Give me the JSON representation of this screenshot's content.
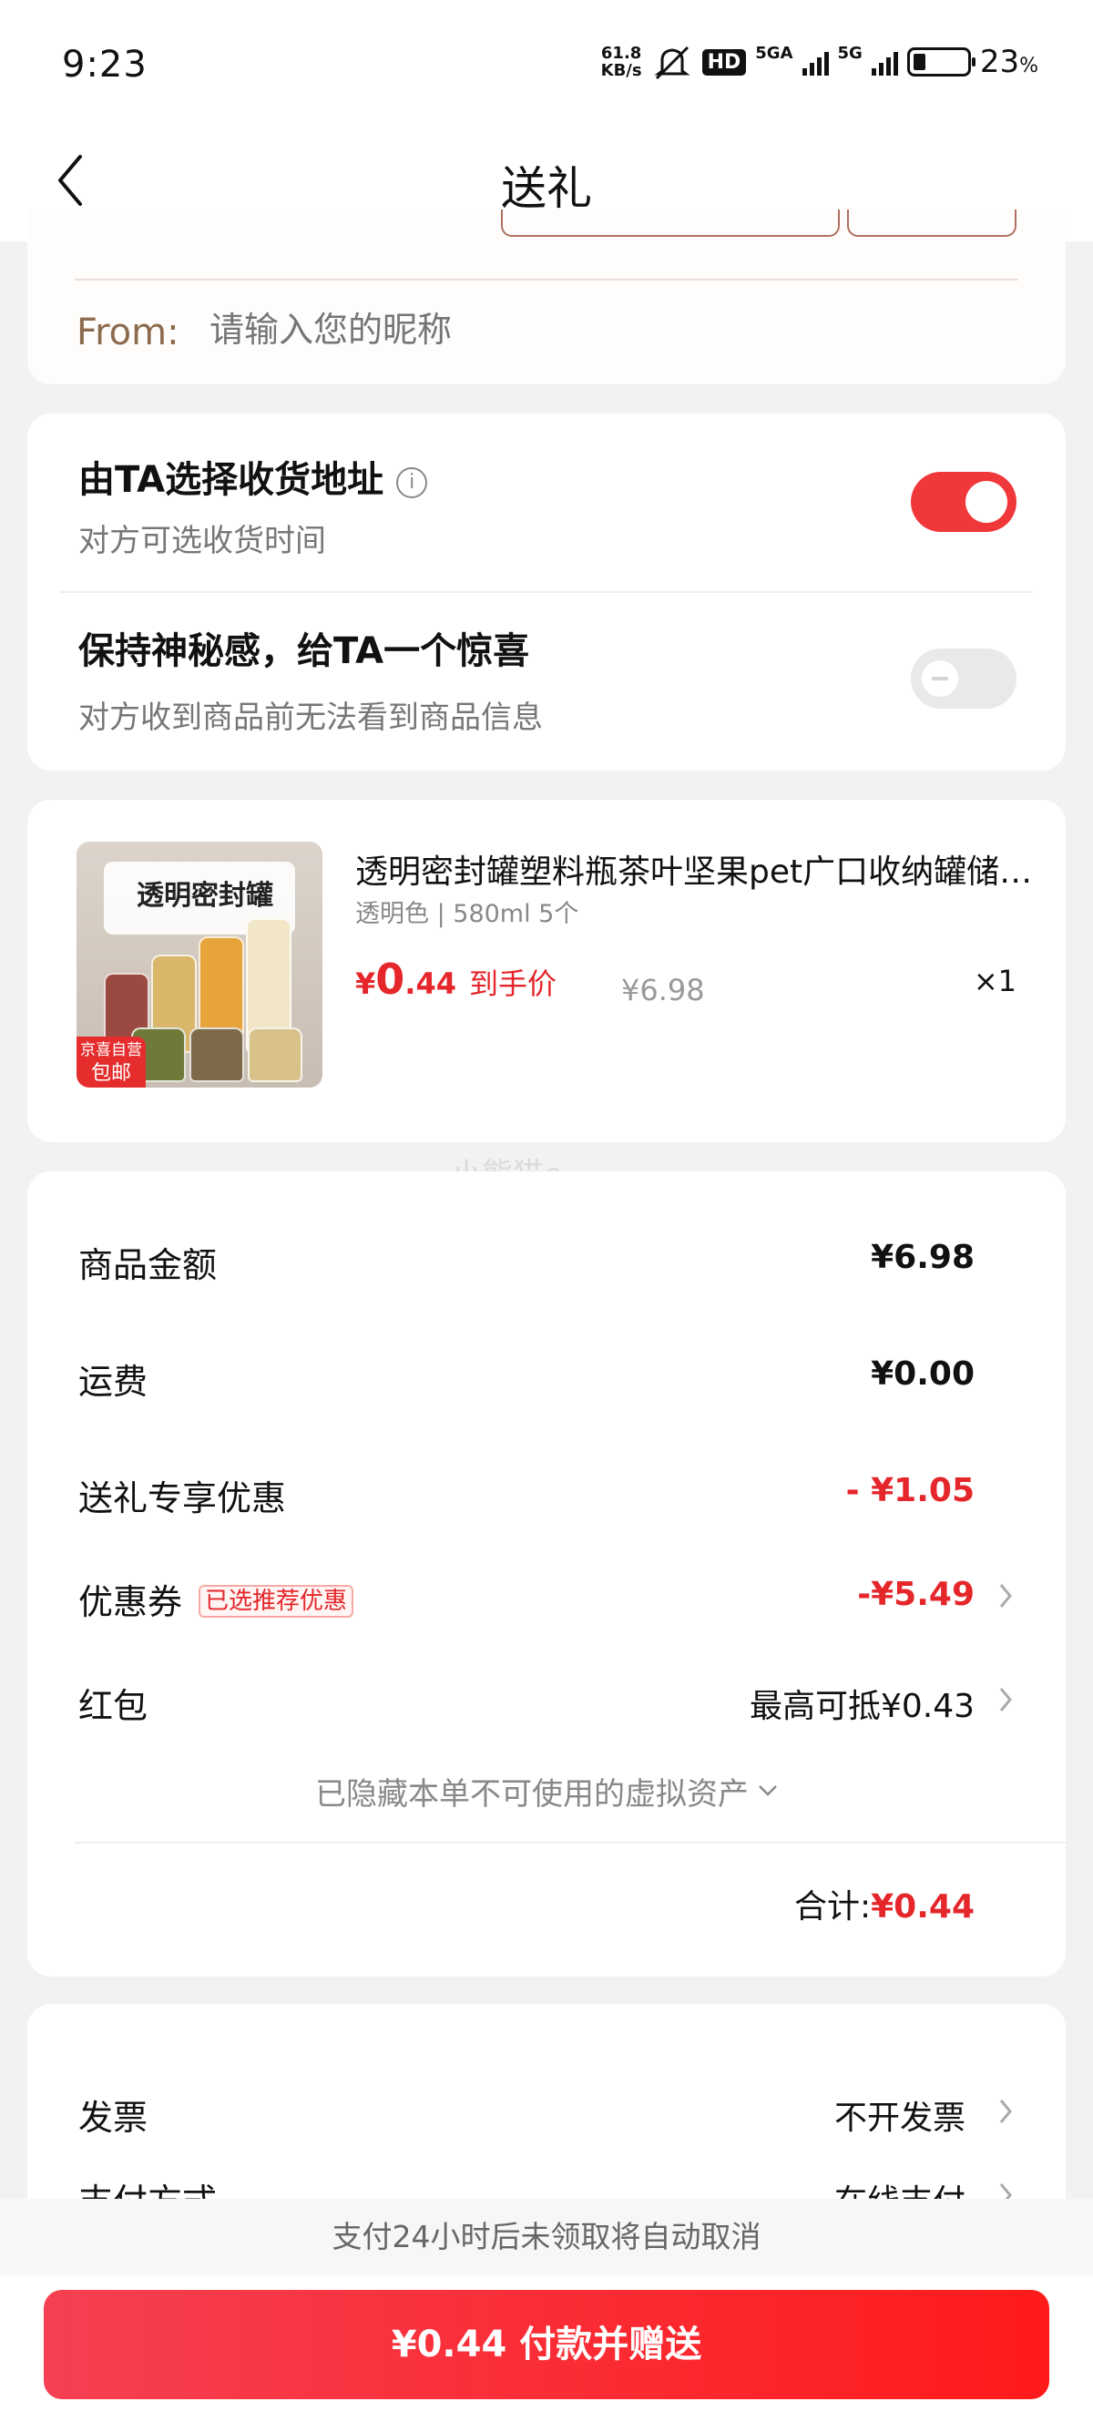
{
  "status_bar": {
    "time": "9:23",
    "net_speed_value": "61.8",
    "net_speed_unit": "KB/s",
    "hd_label": "HD",
    "network_1": "5GA",
    "network_2": "5G",
    "battery_pct": "23",
    "battery_unit": "%",
    "battery_level": 0.23
  },
  "nav": {
    "title": "送礼",
    "back_icon": "chevron-left-icon"
  },
  "from_section": {
    "label": "From:",
    "placeholder": "请输入您的昵称"
  },
  "options": [
    {
      "title": "由TA选择收货地址",
      "subtitle": "对方可选收货时间",
      "enabled": true,
      "info_icon": "info-icon"
    },
    {
      "title": "保持神秘感，给TA一个惊喜",
      "subtitle": "对方收到商品前无法看到商品信息",
      "enabled": false
    }
  ],
  "product": {
    "image_banner": "透明密封罐",
    "image_tag_line1": "京喜自营",
    "image_tag_line2": "包邮",
    "title": "透明密封罐塑料瓶茶叶坚果pet广口收纳罐储物罐",
    "spec": "透明色 | 580ml 5个",
    "price_symbol": "¥",
    "price_int": "0",
    "price_dec": ".44",
    "price_label": "到手价",
    "original_price": "¥6.98",
    "quantity": "×1"
  },
  "watermark": "小熊猫c",
  "totals": {
    "rows": [
      {
        "label": "商品金额",
        "value": "¥6.98"
      },
      {
        "label": "运费",
        "value": "¥0.00"
      },
      {
        "label": "送礼专享优惠",
        "value": "- ¥1.05"
      },
      {
        "label": "优惠券",
        "badge": "已选推荐优惠",
        "value": "-¥5.49"
      },
      {
        "label": "红包",
        "value": "最高可抵¥0.43"
      }
    ],
    "hidden_note": "已隐藏本单不可使用的虚拟资产",
    "sum_label": "合计:",
    "sum_value": "¥0.44"
  },
  "invoice": {
    "rows": [
      {
        "label": "发票",
        "value": "不开发票"
      },
      {
        "label": "支付方式",
        "value": "在线支付"
      }
    ]
  },
  "bottom": {
    "notice": "支付24小时后未领取将自动取消",
    "pay_button": "¥0.44 付款并赠送"
  },
  "colors": {
    "accent_red": "#e5262a",
    "toggle_on": "#f0373a",
    "button_gradient_start": "#f54052",
    "button_gradient_end": "#ff1a1a"
  }
}
